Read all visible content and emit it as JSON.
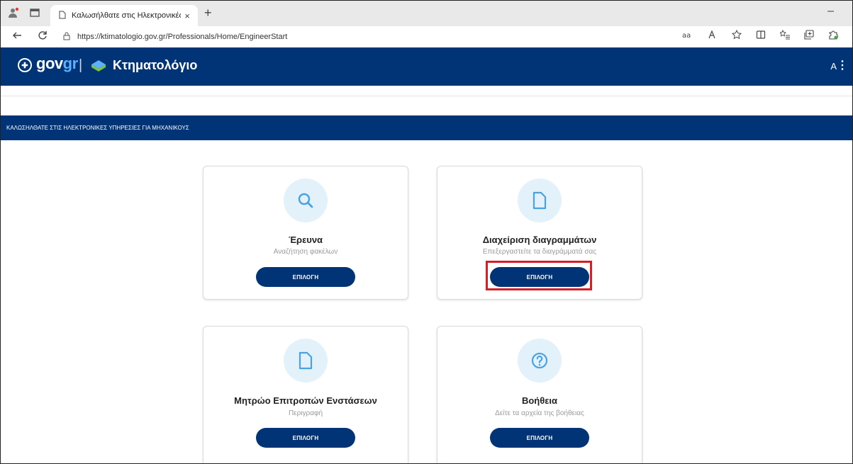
{
  "browser": {
    "tab_title": "Καλωσήλθατε στις Ηλεκτρονικές",
    "tab_close": "×",
    "new_tab": "+",
    "minimize": "–",
    "url": "https://ktimatologio.gov.gr/Professionals/Home/EngineerStart"
  },
  "header": {
    "gov": "gov",
    "gr": "gr",
    "separator": "|",
    "site_name": "Κτηματολόγιο",
    "user_initial": "A",
    "menu": "⋮"
  },
  "banner": {
    "text": "ΚΑΛΩΣΗΛΘΑΤΕ ΣΤΙΣ ΗΛΕΚΤΡΟΝΙΚΕΣ ΥΠΗΡΕΣΙΕΣ ΓΙΑ ΜΗΧΑΝΙΚΟΥΣ"
  },
  "cards": [
    {
      "title": "Έρευνα",
      "subtitle": "Αναζήτηση φακέλων",
      "button": "ΕΠΙΛΟΓΗ",
      "icon": "search-icon"
    },
    {
      "title": "Διαχείριση διαγραμμάτων",
      "subtitle": "Επεξεργαστείτε τα διαγράμματά σας",
      "button": "ΕΠΙΛΟΓΗ",
      "icon": "document-icon"
    },
    {
      "title": "Μητρώο Επιτροπών Ενστάσεων",
      "subtitle": "Περιγραφή",
      "button": "ΕΠΙΛΟΓΗ",
      "icon": "document-icon"
    },
    {
      "title": "Βοήθεια",
      "subtitle": "Δείτε τα αρχεία της βοήθειας",
      "button": "ΕΠΙΛΟΓΗ",
      "icon": "help-icon"
    }
  ],
  "colors": {
    "brand_blue": "#003476",
    "icon_bg": "#e3f1fa",
    "icon_stroke": "#4aa3df",
    "highlight": "#d51f26"
  }
}
